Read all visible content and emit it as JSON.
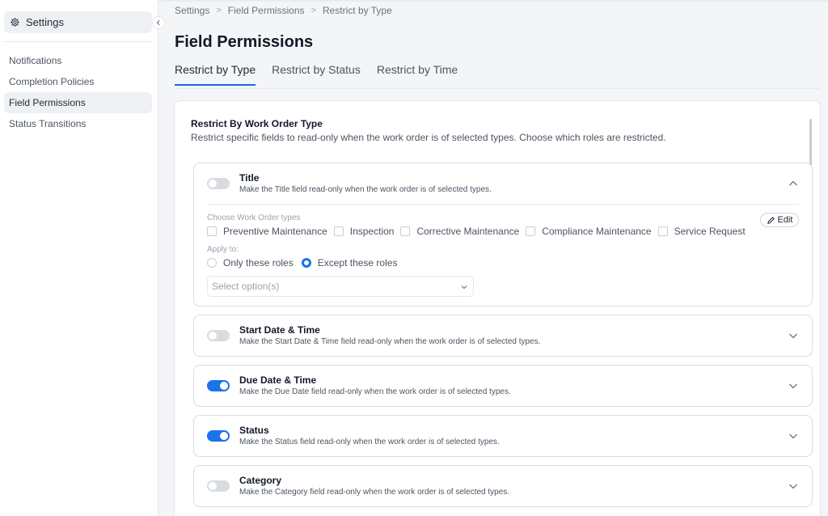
{
  "sidebar": {
    "settings_label": "Settings",
    "items": [
      {
        "label": "Notifications",
        "active": false
      },
      {
        "label": "Completion Policies",
        "active": false
      },
      {
        "label": "Field Permissions",
        "active": true
      },
      {
        "label": "Status Transitions",
        "active": false
      }
    ]
  },
  "breadcrumb": [
    "Settings",
    "Field Permissions",
    "Restrict by Type"
  ],
  "page_title": "Field Permissions",
  "tabs": [
    {
      "label": "Restrict by Type",
      "active": true
    },
    {
      "label": "Restrict by Status",
      "active": false
    },
    {
      "label": "Restrict by Time",
      "active": false
    }
  ],
  "card": {
    "title": "Restrict By Work Order Type",
    "description": "Restrict specific fields to read-only when the work order is of selected types. Choose which roles are restricted."
  },
  "fields": [
    {
      "title": "Title",
      "description": "Make the Title field read-only when the work order is of selected types.",
      "enabled": false,
      "expanded": true
    },
    {
      "title": "Start Date & Time",
      "description": "Make the Start Date & Time field read-only when the work order is of selected types.",
      "enabled": false,
      "expanded": false
    },
    {
      "title": "Due Date & Time",
      "description": "Make the Due Date field read-only when the work order is of selected types.",
      "enabled": true,
      "expanded": false
    },
    {
      "title": "Status",
      "description": "Make the Status field read-only when the work order is of selected types.",
      "enabled": true,
      "expanded": false
    },
    {
      "title": "Category",
      "description": "Make the Category field read-only when the work order is of selected types.",
      "enabled": false,
      "expanded": false
    }
  ],
  "expanded_panel": {
    "types_label": "Choose Work Order types",
    "types": [
      "Preventive Maintenance",
      "Inspection",
      "Corrective Maintenance",
      "Compliance Maintenance",
      "Service Request"
    ],
    "edit_label": "Edit",
    "apply_label": "Apply to:",
    "roles_options": [
      {
        "label": "Only these roles",
        "selected": false
      },
      {
        "label": "Except these roles",
        "selected": true
      }
    ],
    "select_placeholder": "Select option(s)"
  },
  "colors": {
    "accent": "#1a73e8",
    "toggle_off": "#d8dbe0"
  }
}
